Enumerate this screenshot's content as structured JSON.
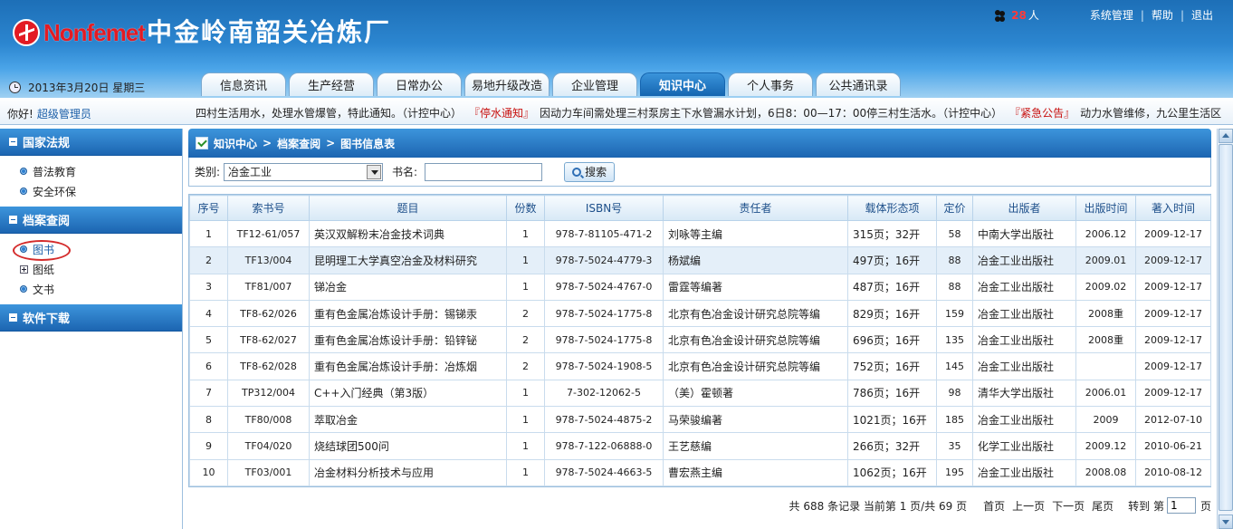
{
  "header": {
    "brand": "Nonfemet",
    "site_title": "中金岭南韶关冶炼厂",
    "online_count": "28",
    "online_unit": "人",
    "links": {
      "system": "系统管理",
      "help": "帮助",
      "logout": "退出"
    },
    "date": "2013年3月20日 星期三"
  },
  "nav": {
    "tabs": [
      "信息资讯",
      "生产经营",
      "日常办公",
      "易地升级改造",
      "企业管理",
      "知识中心",
      "个人事务",
      "公共通讯录"
    ],
    "active": "知识中心"
  },
  "info_bar": {
    "greeting": "你好!",
    "user": "超级管理员",
    "ticker_1": "四村生活用水，处理水管爆管，特此通知。（计控中心）",
    "tag_1": "『停水通知』",
    "ticker_2": "因动力车间需处理三村泵房主下水管漏水计划，6日8：00—17：00停三村生活水。（计控中心）",
    "tag_2": "『紧急公告』",
    "ticker_3": "动力水管维修，九公里生活区"
  },
  "sidebar": {
    "sections": [
      {
        "title": "国家法规",
        "items": [
          {
            "label": "普法教育"
          },
          {
            "label": "安全环保"
          }
        ]
      },
      {
        "title": "档案查阅",
        "items": [
          {
            "label": "图书"
          },
          {
            "label": "图纸"
          },
          {
            "label": "文书"
          }
        ]
      },
      {
        "title": "软件下载",
        "items": []
      }
    ]
  },
  "main": {
    "breadcrumb": [
      "知识中心",
      "档案查阅",
      "图书信息表"
    ],
    "search": {
      "category_label": "类别:",
      "category_value": "冶金工业",
      "name_label": "书名:",
      "name_value": "",
      "button": "搜索"
    },
    "table": {
      "headers": [
        "序号",
        "索书号",
        "题目",
        "份数",
        "ISBN号",
        "责任者",
        "载体形态项",
        "定价",
        "出版者",
        "出版时间",
        "著入时间"
      ],
      "rows": [
        [
          "1",
          "TF12-61/057",
          "英汉双解粉末冶金技术词典",
          "1",
          "978-7-81105-471-2",
          "刘咏等主编",
          "315页；32开",
          "58",
          "中南大学出版社",
          "2006.12",
          "2009-12-17"
        ],
        [
          "2",
          "TF13/004",
          "昆明理工大学真空冶金及材料研究",
          "1",
          "978-7-5024-4779-3",
          "杨斌编",
          "497页；16开",
          "88",
          "冶金工业出版社",
          "2009.01",
          "2009-12-17"
        ],
        [
          "3",
          "TF81/007",
          "锑冶金",
          "1",
          "978-7-5024-4767-0",
          "雷霆等编著",
          "487页；16开",
          "88",
          "冶金工业出版社",
          "2009.02",
          "2009-12-17"
        ],
        [
          "4",
          "TF8-62/026",
          "重有色金属冶炼设计手册：锡锑汞",
          "2",
          "978-7-5024-1775-8",
          "北京有色冶金设计研究总院等编",
          "829页；16开",
          "159",
          "冶金工业出版社",
          "2008重",
          "2009-12-17"
        ],
        [
          "5",
          "TF8-62/027",
          "重有色金属冶炼设计手册：铅锌铋",
          "2",
          "978-7-5024-1775-8",
          "北京有色冶金设计研究总院等编",
          "696页；16开",
          "135",
          "冶金工业出版社",
          "2008重",
          "2009-12-17"
        ],
        [
          "6",
          "TF8-62/028",
          "重有色金属冶炼设计手册：冶炼烟",
          "2",
          "978-7-5024-1908-5",
          "北京有色冶金设计研究总院等编",
          "752页；16开",
          "145",
          "冶金工业出版社",
          "",
          "2009-12-17"
        ],
        [
          "7",
          "TP312/004",
          "C++入门经典（第3版）",
          "1",
          "7-302-12062-5",
          "（美）霍顿著",
          "786页；16开",
          "98",
          "清华大学出版社",
          "2006.01",
          "2009-12-17"
        ],
        [
          "8",
          "TF80/008",
          "萃取冶金",
          "1",
          "978-7-5024-4875-2",
          "马荣骏编著",
          "1021页；16开",
          "185",
          "冶金工业出版社",
          "2009",
          "2012-07-10"
        ],
        [
          "9",
          "TF04/020",
          "烧结球团500问",
          "1",
          "978-7-122-06888-0",
          "王艺慈编",
          "266页；32开",
          "35",
          "化学工业出版社",
          "2009.12",
          "2010-06-21"
        ],
        [
          "10",
          "TF03/001",
          "冶金材料分析技术与应用",
          "1",
          "978-7-5024-4663-5",
          "曹宏燕主编",
          "1062页；16开",
          "195",
          "冶金工业出版社",
          "2008.08",
          "2010-08-12"
        ]
      ]
    },
    "pager": {
      "summary": "共 688 条记录 当前第 1 页/共 69 页",
      "first": "首页",
      "prev": "上一页",
      "next": "下一页",
      "last": "尾页",
      "goto_prefix": "转到 第",
      "page_value": "1",
      "goto_suffix": "页"
    }
  },
  "colors": {
    "header_blue": "#1d6fb7",
    "active_tab": "#1565b0",
    "alert_red": "#c8100e",
    "brand_red": "#e31b23"
  }
}
